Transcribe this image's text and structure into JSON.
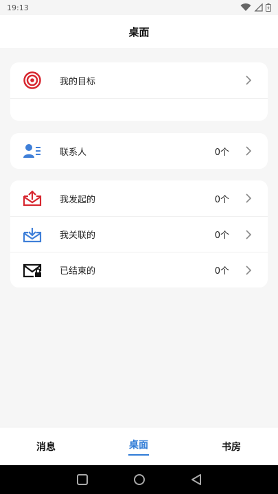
{
  "status": {
    "time": "19:13"
  },
  "header": {
    "title": "桌面"
  },
  "cards": {
    "goal": {
      "label": "我的目标"
    },
    "contacts": {
      "label": "联系人",
      "count": "0个"
    },
    "initiated": {
      "label": "我发起的",
      "count": "0个"
    },
    "related": {
      "label": "我关联的",
      "count": "0个"
    },
    "finished": {
      "label": "已结束的",
      "count": "0个"
    }
  },
  "tabs": [
    {
      "label": "消息"
    },
    {
      "label": "桌面"
    },
    {
      "label": "书房"
    }
  ],
  "colors": {
    "accent": "#2f7bd6",
    "target_red": "#d7262f",
    "contacts_blue": "#3f7fd8",
    "initiated_red": "#d7262f",
    "related_blue": "#3f7fd8",
    "finished_black": "#111111"
  },
  "icons": {
    "goal": "target-icon",
    "contacts": "contacts-icon",
    "initiated": "outbox-icon",
    "related": "inbox-icon",
    "finished": "archive-mail-icon"
  }
}
